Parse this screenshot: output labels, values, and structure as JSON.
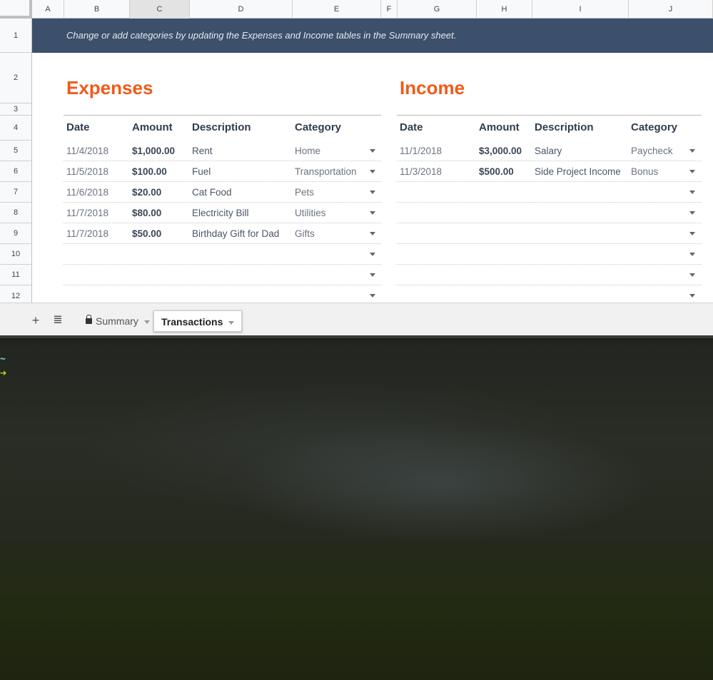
{
  "columns": [
    {
      "label": "A",
      "selected": false
    },
    {
      "label": "B",
      "selected": false
    },
    {
      "label": "C",
      "selected": true
    },
    {
      "label": "D",
      "selected": false
    },
    {
      "label": "E",
      "selected": false
    },
    {
      "label": "F",
      "selected": false
    },
    {
      "label": "G",
      "selected": false
    },
    {
      "label": "H",
      "selected": false
    },
    {
      "label": "I",
      "selected": false
    },
    {
      "label": "J",
      "selected": false
    }
  ],
  "rows": [
    "1",
    "2",
    "3",
    "4",
    "5",
    "6",
    "7",
    "8",
    "9",
    "10",
    "11",
    "12"
  ],
  "banner_text": "Change or add categories by updating the Expenses and Income tables in the Summary sheet.",
  "expenses": {
    "title": "Expenses",
    "headers": [
      "Date",
      "Amount",
      "Description",
      "Category"
    ],
    "entries": [
      {
        "date": "11/4/2018",
        "amount": "$1,000.00",
        "description": "Rent",
        "category": "Home"
      },
      {
        "date": "11/5/2018",
        "amount": "$100.00",
        "description": "Fuel",
        "category": "Transportation"
      },
      {
        "date": "11/6/2018",
        "amount": "$20.00",
        "description": "Cat Food",
        "category": "Pets"
      },
      {
        "date": "11/7/2018",
        "amount": "$80.00",
        "description": "Electricity Bill",
        "category": "Utilities"
      },
      {
        "date": "11/7/2018",
        "amount": "$50.00",
        "description": "Birthday Gift for Dad",
        "category": "Gifts"
      },
      {
        "date": "",
        "amount": "",
        "description": "",
        "category": ""
      },
      {
        "date": "",
        "amount": "",
        "description": "",
        "category": ""
      },
      {
        "date": "",
        "amount": "",
        "description": "",
        "category": ""
      }
    ]
  },
  "income": {
    "title": "Income",
    "headers": [
      "Date",
      "Amount",
      "Description",
      "Category"
    ],
    "entries": [
      {
        "date": "11/1/2018",
        "amount": "$3,000.00",
        "description": "Salary",
        "category": "Paycheck"
      },
      {
        "date": "11/3/2018",
        "amount": "$500.00",
        "description": "Side Project Income",
        "category": "Bonus"
      },
      {
        "date": "",
        "amount": "",
        "description": "",
        "category": ""
      },
      {
        "date": "",
        "amount": "",
        "description": "",
        "category": ""
      },
      {
        "date": "",
        "amount": "",
        "description": "",
        "category": ""
      },
      {
        "date": "",
        "amount": "",
        "description": "",
        "category": ""
      },
      {
        "date": "",
        "amount": "",
        "description": "",
        "category": ""
      },
      {
        "date": "",
        "amount": "",
        "description": "",
        "category": ""
      }
    ]
  },
  "tabbar": {
    "add_icon": "plus-icon",
    "list_icon": "list-icon",
    "tabs": [
      {
        "label": "Summary",
        "locked": true,
        "active": false
      },
      {
        "label": "Transactions",
        "locked": false,
        "active": true
      }
    ]
  },
  "terminal": {
    "cwd": "~",
    "prompt_symbol": "➜"
  },
  "colors": {
    "banner_bg": "#3c4f6b",
    "title_accent": "#f05a1a",
    "prompt": "#a8e22e",
    "cwd": "#7fdbe6"
  }
}
